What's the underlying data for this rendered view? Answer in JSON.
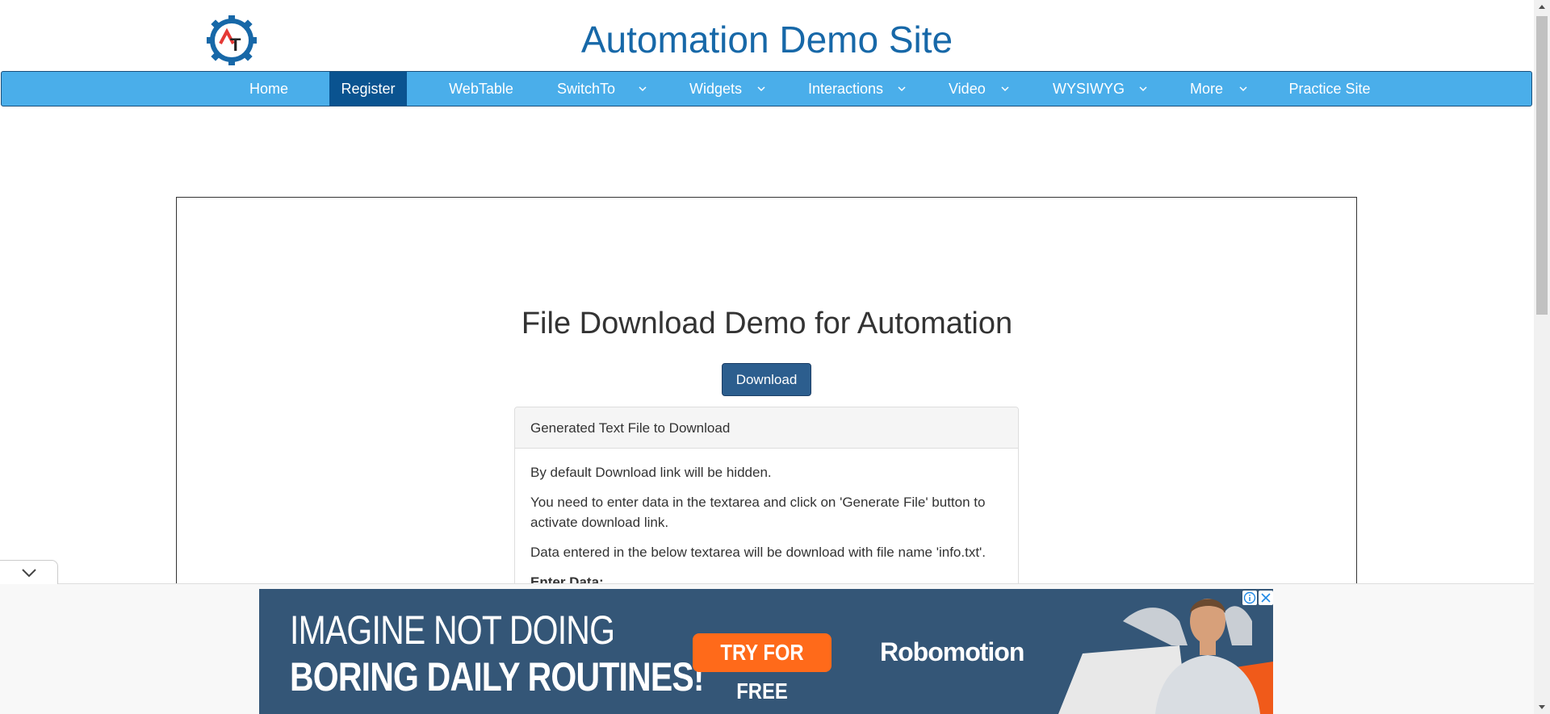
{
  "header": {
    "site_title": "Automation Demo Site",
    "logo_text": "AT"
  },
  "nav": {
    "items": [
      {
        "label": "Home",
        "dropdown": false,
        "active": false
      },
      {
        "label": "Register",
        "dropdown": false,
        "active": true
      },
      {
        "label": "WebTable",
        "dropdown": false,
        "active": false
      },
      {
        "label": "SwitchTo",
        "dropdown": true,
        "active": false
      },
      {
        "label": "Widgets",
        "dropdown": true,
        "active": false
      },
      {
        "label": "Interactions",
        "dropdown": true,
        "active": false
      },
      {
        "label": "Video",
        "dropdown": true,
        "active": false
      },
      {
        "label": "WYSIWYG",
        "dropdown": true,
        "active": false
      },
      {
        "label": "More",
        "dropdown": true,
        "active": false
      },
      {
        "label": "Practice Site",
        "dropdown": false,
        "active": false
      }
    ]
  },
  "main": {
    "heading": "File Download Demo for Automation",
    "download_label": "Download",
    "card": {
      "title": "Generated Text File to Download",
      "paragraphs": [
        "By default Download link will be hidden.",
        "You need to enter data in the textarea and click on 'Generate File' button to activate download link.",
        "Data entered in the below textarea will be download with file name 'info.txt'."
      ],
      "enter_data_label": "Enter Data:"
    }
  },
  "ad": {
    "line1": "IMAGINE NOT DOING",
    "line2": "BORING DAILY ROUTINES!",
    "cta": "TRY FOR FREE",
    "brand": "Robomotion"
  },
  "colors": {
    "title_blue": "#1768a8",
    "nav_bg": "#4aaeea",
    "nav_active": "#0a5390",
    "button_bg": "#2c5e8e",
    "ad_bg": "#345677",
    "ad_cta": "#ff6a1a"
  }
}
